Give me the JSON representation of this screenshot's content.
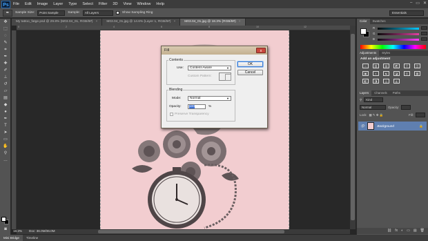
{
  "menu": {
    "logo": "Ps",
    "items": [
      "File",
      "Edit",
      "Image",
      "Layer",
      "Type",
      "Select",
      "Filter",
      "3D",
      "View",
      "Window",
      "Help"
    ],
    "window_controls": [
      "–",
      "▭",
      "✕"
    ]
  },
  "options": {
    "tool_glyph": "✒",
    "sample_size_label": "Sample Size:",
    "sample_size_value": "Point Sample",
    "sample_label": "Sample:",
    "sample_value": "All Layers",
    "show_ring_label": "Show Sampling Ring",
    "workspace": "Essentials"
  },
  "tabs": [
    {
      "label": "My tattoo_fatge.psd @ 29.8% (M03.04_01, RGB/8#)",
      "active": false
    },
    {
      "label": "M03.04_01.jpg @ 14.6% (Layer 1, RGB/8#)",
      "active": false
    },
    {
      "label": "M03.04_01.jpg @ 18.3% (RGB/8#)",
      "active": true
    }
  ],
  "ruler": {
    "ticks": [
      "0",
      "2",
      "4",
      "6",
      "8",
      "10",
      "12"
    ]
  },
  "status": {
    "zoom": "18.3%",
    "doc": "Doc: 36.0M/36.0M"
  },
  "bottom_tabs": [
    "Mini Bridge",
    "Timeline"
  ],
  "color_panel": {
    "tabs": [
      "Color",
      "Swatches"
    ],
    "sliders": [
      {
        "label": "R",
        "color": "#00c8ff"
      },
      {
        "label": "G",
        "color": "#e040a0"
      },
      {
        "label": "B",
        "color": "#ff40ff"
      }
    ]
  },
  "adjustments": {
    "tabs": [
      "Adjustments",
      "Styles"
    ],
    "title": "Add an adjustment",
    "icons": [
      "☼",
      "▥",
      "▤",
      "◩",
      "▽",
      "◫",
      "▣",
      "◐",
      "☯",
      "◪",
      "◎",
      "▦",
      "◧",
      "◨",
      "◬",
      "◭"
    ]
  },
  "layers": {
    "tabs": [
      "Layers",
      "Channels",
      "Paths"
    ],
    "kind": "Kind",
    "blend": "Normal",
    "opacity_label": "Opacity:",
    "lock_label": "Lock:",
    "fill_label": "Fill:",
    "layer_name": "Background",
    "footer_icons": [
      "⛓",
      "fx",
      "◐",
      "▭",
      "▤",
      "🗑"
    ]
  },
  "dialog": {
    "title": "Fill",
    "close": "x",
    "contents_label": "Contents",
    "use_label": "Use:",
    "use_value": "Content-Aware",
    "custom_pattern_label": "Custom Pattern:",
    "blending_label": "Blending",
    "mode_label": "Mode:",
    "mode_value": "Normal",
    "opacity_label": "Opacity:",
    "opacity_value": "100",
    "opacity_unit": "%",
    "preserve_label": "Preserve Transparency",
    "ok_label": "OK",
    "cancel_label": "Cancel"
  }
}
